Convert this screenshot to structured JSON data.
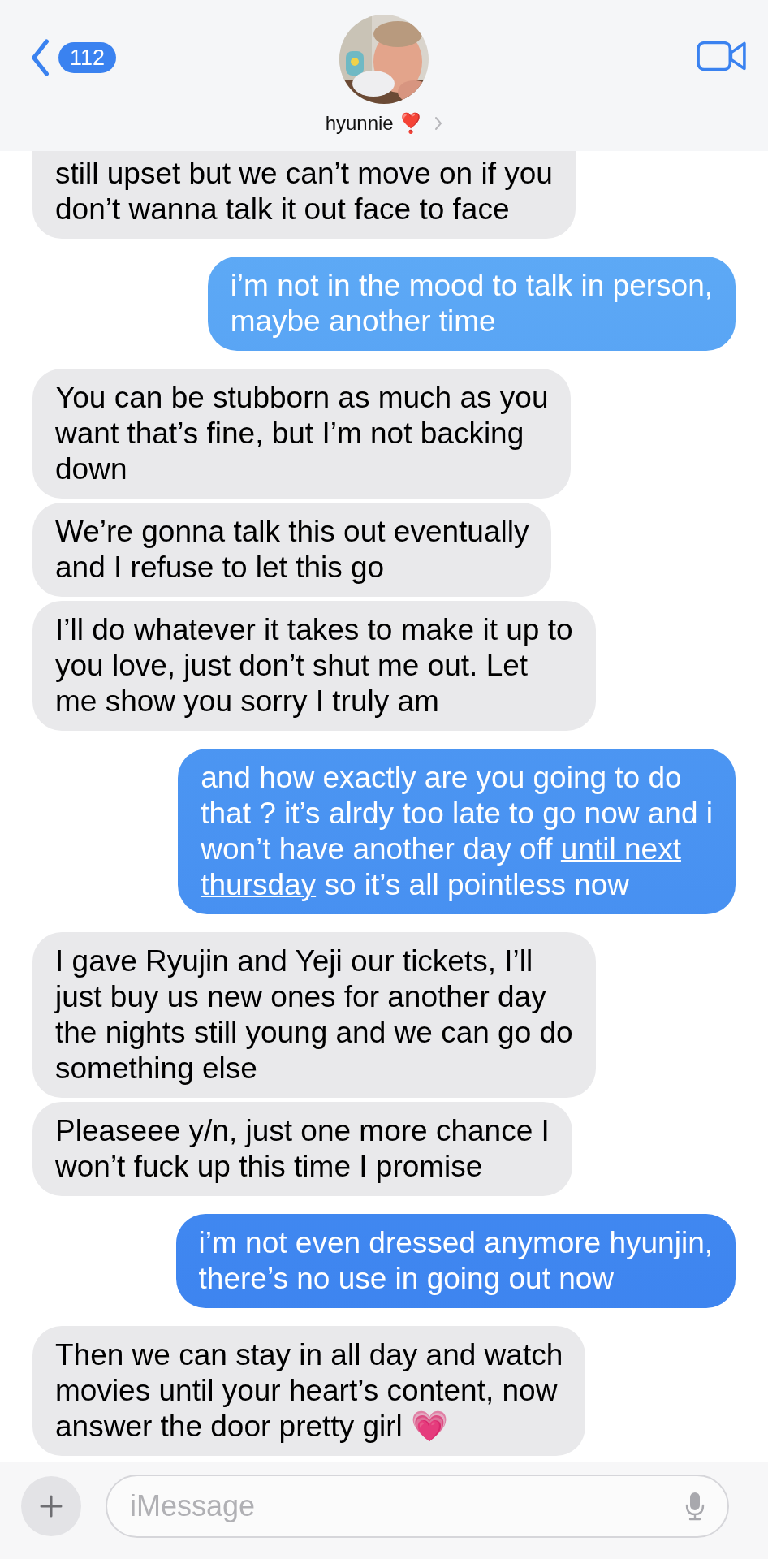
{
  "header": {
    "back_count": "112",
    "contact_name": "hyunnie ❣️"
  },
  "messages": [
    {
      "kind": "received",
      "text": "still upset but we can’t move on if you\ndon’t wanna talk it out face to face"
    },
    {
      "kind": "sent",
      "text": "i’m not in the mood to talk in person,\nmaybe another time"
    },
    {
      "kind": "received",
      "text": "You can be stubborn as much as you\nwant that’s fine, but I’m not backing\ndown"
    },
    {
      "kind": "received",
      "text": "We’re gonna talk this out eventually\nand I refuse to let this go"
    },
    {
      "kind": "received",
      "text": "I’ll do whatever it takes to make it up to\nyou love, just don’t shut me out. Let\nme show you sorry I truly am"
    },
    {
      "kind": "sent",
      "parts": [
        {
          "kind": "text",
          "text": "and how exactly are you going to do\nthat ? it’s alrdy too late to go now and i\nwon’t have another day off "
        },
        {
          "kind": "link",
          "text": "until next"
        },
        {
          "kind": "break"
        },
        {
          "kind": "link",
          "text": "thursday"
        },
        {
          "kind": "text",
          "text": " so it’s all pointless now"
        }
      ]
    },
    {
      "kind": "received",
      "text": "I gave Ryujin and Yeji our tickets, I’ll\njust buy us new ones for another day\nthe nights still young and we can go do\nsomething else"
    },
    {
      "kind": "received",
      "text": "Pleaseee y/n, just one more chance I\nwon’t fuck up this time I promise"
    },
    {
      "kind": "sent",
      "text": "i’m not even dressed anymore hyunjin,\nthere’s no use in going out now"
    },
    {
      "kind": "received",
      "text": "Then we can stay in all day and watch\nmovies until your heart’s content, now\nanswer the door pretty girl 💗"
    }
  ],
  "composer": {
    "placeholder": "iMessage"
  }
}
